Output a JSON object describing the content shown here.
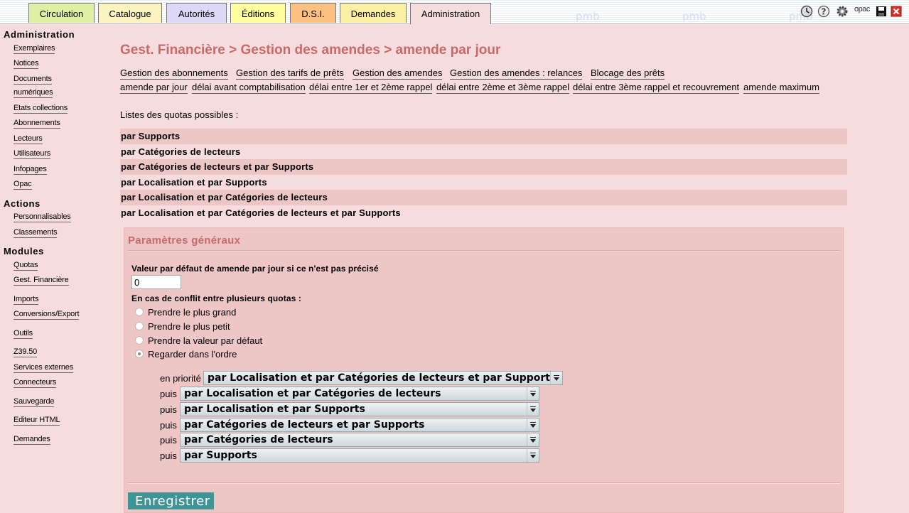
{
  "tabs": [
    {
      "label": "Circulation",
      "color": "#dff0a4"
    },
    {
      "label": "Catalogue",
      "color": "#fbf4c0"
    },
    {
      "label": "Autorités",
      "color": "#ddd8f6"
    },
    {
      "label": "Éditions",
      "color": "#ffff9f"
    },
    {
      "label": "D.S.I.",
      "color": "#fcc080"
    },
    {
      "label": "Demandes",
      "color": "#fdf0a4"
    },
    {
      "label": "Administration",
      "color": "#f6dcdc",
      "active": true
    }
  ],
  "watermark": "pmb",
  "top_icons": [
    "history-icon",
    "help-icon",
    "preferences-gear-icon",
    "opac-link-icon",
    "save-disk-icon",
    "logout-close-icon"
  ],
  "top_icon_text": {
    "opac": "opac"
  },
  "sidebar": {
    "admin_title": "Administration",
    "admin_items": [
      "Exemplaires",
      "Notices",
      "Documents",
      "numériques",
      "Etats collections",
      "Abonnements",
      "Lecteurs",
      "Utilisateurs",
      "Infopages",
      "Opac"
    ],
    "actions_title": "Actions",
    "actions_items": [
      "Personnalisables",
      "Classements"
    ],
    "modules_title": "Modules",
    "modules_items": [
      "Quotas",
      "Gest. Financière",
      "Imports",
      "Conversions/Export",
      "Outils",
      "Z39.50",
      "Services externes",
      "Connecteurs",
      "Sauvegarde",
      "Editeur HTML",
      "Demandes"
    ]
  },
  "main": {
    "title": "Gest. Financière > Gestion des amendes > amende par jour",
    "menu_row1": [
      "Gestion des abonnements",
      "Gestion des tarifs de prêts",
      "Gestion des amendes",
      "Gestion des amendes : relances",
      "Blocage des prêts"
    ],
    "menu_row2": [
      "amende par jour",
      "délai avant comptabilisation",
      "délai entre 1er et 2ème rappel",
      "délai entre 2ème et 3ème rappel",
      "délai entre 3ème rappel et recouvrement",
      "amende maximum"
    ],
    "list_intro": "Listes des quotas possibles :",
    "quota_list": [
      "par Supports",
      "par Catégories de lecteurs",
      "par Catégories de lecteurs et par Supports",
      "par Localisation et par Supports",
      "par Localisation et par Catégories de lecteurs",
      "par Localisation et par Catégories de lecteurs et par Supports"
    ],
    "params": {
      "title": "Paramètres généraux",
      "default_label": "Valeur par défaut de amende par jour si ce n'est pas précisé",
      "default_value": "0",
      "conflict_label": "En cas de conflit entre plusieurs quotas :",
      "conflict_options": [
        "Prendre le plus grand",
        "Prendre le plus petit",
        "Prendre la valeur par défaut",
        "Regarder dans l'ordre"
      ],
      "conflict_selected": 3,
      "priority_first_label": "en priorité",
      "priority_next_label": "puis",
      "priority_order": [
        "par Localisation et par Catégories de lecteurs et par Supports",
        "par Localisation et par Catégories de lecteurs",
        "par Localisation et par Supports",
        "par Catégories de lecteurs et par Supports",
        "par Catégories de lecteurs",
        "par Supports"
      ],
      "save_label": "Enregistrer"
    }
  }
}
